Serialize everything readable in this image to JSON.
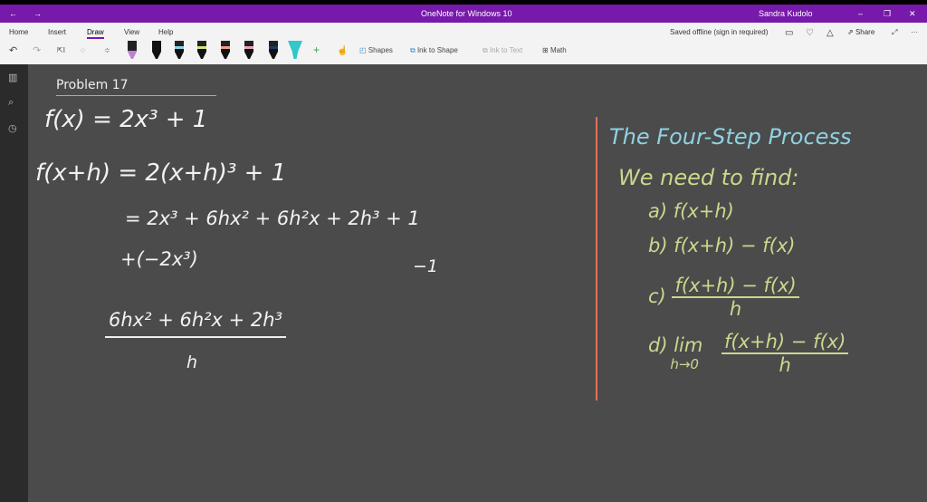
{
  "titlebar": {
    "title": "OneNote for Windows 10",
    "user": "Sandra Kudolo",
    "back": "←",
    "forward": "→",
    "minimize": "–",
    "restore": "❐",
    "close": "✕"
  },
  "ribbon": {
    "tabs": [
      "Home",
      "Insert",
      "Draw",
      "View",
      "Help"
    ],
    "active_tab": "Draw",
    "status": "Saved offline (sign in required)",
    "share": "Share",
    "more": "···",
    "tools": {
      "shapes": "Shapes",
      "ink_to_shape": "Ink to Shape",
      "ink_to_text": "Ink to Text",
      "math": "Math"
    },
    "pens": [
      "#c080d0",
      "#000000",
      "#7fd7f0",
      "#d8e07a",
      "#f0a080",
      "#f0a0c0",
      "#1a3a6a",
      "#30c8c8"
    ]
  },
  "page": {
    "title": "Problem 17",
    "left": {
      "l1": "f(x) = 2x³ + 1",
      "l2": "f(x+h) = 2(x+h)³ + 1",
      "l3": "= 2x³ + 6hx² + 6h²x + 2h³ + 1",
      "l4": "+(−2x³)",
      "l4b": "−1",
      "num": "6hx² + 6h²x + 2h³",
      "den": "h"
    },
    "right": {
      "title": "The Four-Step Process",
      "intro": "We need to find:",
      "a": "a) f(x+h)",
      "b": "b) f(x+h) − f(x)",
      "c_label": "c)",
      "c_num": "f(x+h) − f(x)",
      "c_den": "h",
      "d_label": "d) lim",
      "d_sub": "h→0",
      "d_num": "f(x+h) − f(x)",
      "d_den": "h"
    }
  },
  "colors": {
    "accent": "#7719aa",
    "canvas": "#4b4b4b",
    "margin_line": "#e0705a",
    "ink_right": "#c9d98c",
    "ink_title": "#8fd2e2"
  }
}
